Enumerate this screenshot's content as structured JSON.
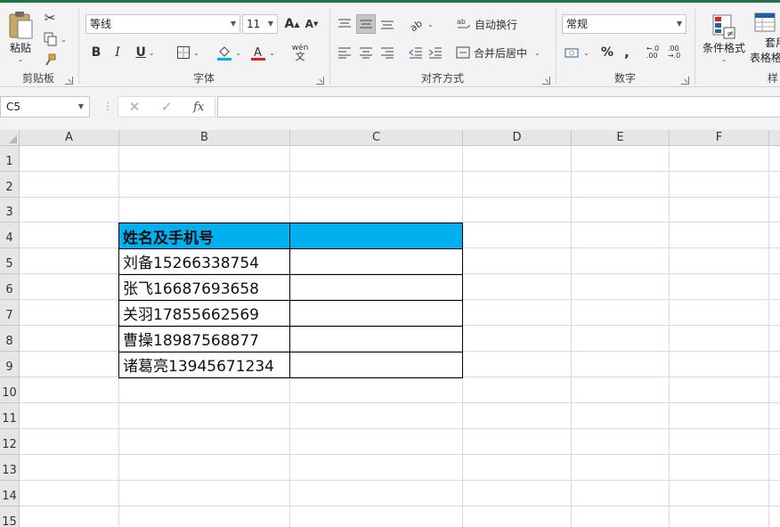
{
  "ribbon": {
    "clipboard": {
      "title": "剪贴板",
      "paste_label": "粘贴"
    },
    "font": {
      "title": "字体",
      "font_name": "等线",
      "font_size": "11",
      "bold": "B",
      "italic": "I",
      "underline": "U",
      "increase_font": "A",
      "decrease_font": "A",
      "phonetic": "wén"
    },
    "alignment": {
      "title": "对齐方式",
      "wrap_text": "自动换行",
      "merge_center": "合并后居中"
    },
    "number": {
      "title": "数字",
      "format": "常规",
      "percent": "%",
      "comma": ","
    },
    "styles": {
      "conditional_formatting": "条件格式",
      "format_as_table_line1": "套用",
      "format_as_table_line2": "表格格",
      "styles_partial": "样"
    },
    "colors": {
      "fill": "#00b0f0",
      "font": "#e02020",
      "accent": "#1e7145"
    }
  },
  "formula_bar": {
    "name_box": "C5",
    "cancel": "✕",
    "enter": "✓",
    "fx": "fx",
    "content": ""
  },
  "sheet": {
    "columns": [
      "A",
      "B",
      "C",
      "D",
      "E",
      "F"
    ],
    "rows": [
      "1",
      "2",
      "3",
      "4",
      "5",
      "6",
      "7",
      "8",
      "9",
      "10",
      "11",
      "12",
      "13",
      "14",
      "15"
    ],
    "table": {
      "header": "姓名及手机号",
      "header_fill": "#00b0f0",
      "entries": [
        "刘备15266338754",
        "张飞16687693658",
        "关羽17855662569",
        "曹操18987568877",
        "诸葛亮13945671234"
      ]
    },
    "selected_cell": "C5"
  }
}
